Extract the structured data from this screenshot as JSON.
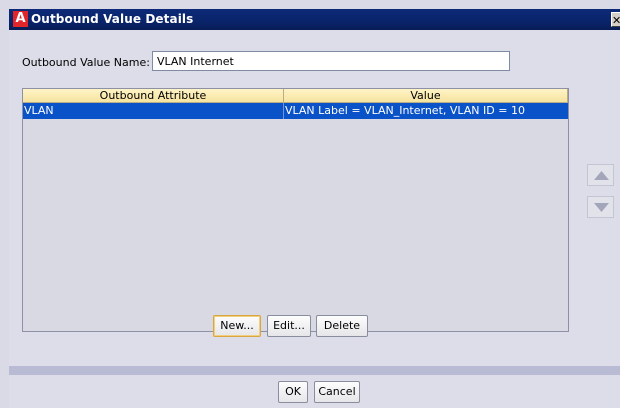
{
  "window": {
    "app_icon": "A",
    "title": "Outbound Value Details",
    "close_label": "✕"
  },
  "form": {
    "name_label": "Outbound Value Name:",
    "name_value": "VLAN Internet"
  },
  "table": {
    "columns": [
      "Outbound Attribute",
      "Value"
    ],
    "rows": [
      {
        "attribute": "VLAN",
        "value": "VLAN Label = VLAN_Internet, VLAN ID = 10",
        "selected": true
      }
    ]
  },
  "actions": {
    "new_label": "New...",
    "edit_label": "Edit...",
    "delete_label": "Delete"
  },
  "footer": {
    "ok_label": "OK",
    "cancel_label": "Cancel"
  },
  "icons": {
    "move_up": "triangle-up-icon",
    "move_down": "triangle-down-icon"
  },
  "colors": {
    "title_bar": "#0a246a",
    "selection": "#0a52c8",
    "header_bg": "#f6e3a0",
    "app_icon": "#e0262b"
  }
}
